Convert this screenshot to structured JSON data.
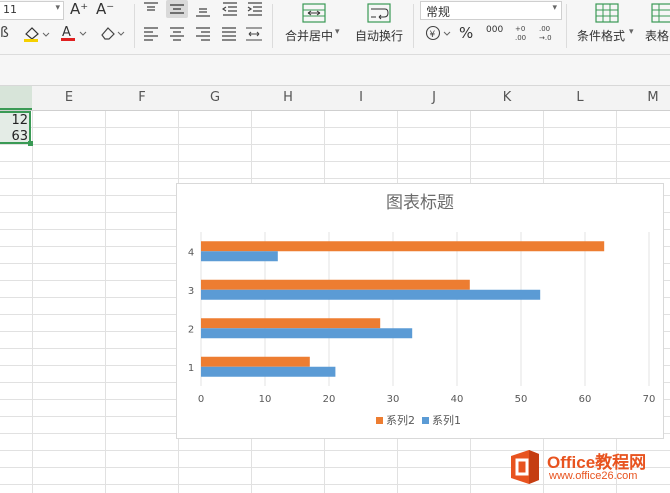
{
  "ribbon": {
    "font_size": "11",
    "font_increase": "A⁺",
    "font_decrease": "A⁻",
    "format_general": "常规",
    "merge_center": "合并居中",
    "wrap_text": "自动换行",
    "conditional_format": "条件格式",
    "table_style": "表格",
    "percent": "%",
    "thousands": "000",
    "dec_increase": "+0\n.00",
    "dec_decrease": ".00\n→.0"
  },
  "columns": [
    "E",
    "F",
    "G",
    "H",
    "I",
    "J",
    "K",
    "L",
    "M"
  ],
  "cells": {
    "d1": "12",
    "d2": "63"
  },
  "chart_data": {
    "type": "bar",
    "orientation": "horizontal",
    "title": "图表标题",
    "categories": [
      "1",
      "2",
      "3",
      "4"
    ],
    "series": [
      {
        "name": "系列2",
        "color": "#ed7d31",
        "values": [
          17,
          28,
          42,
          63
        ]
      },
      {
        "name": "系列1",
        "color": "#5b9bd5",
        "values": [
          21,
          33,
          53,
          12
        ]
      }
    ],
    "xlim": [
      0,
      70
    ],
    "xticks": [
      "0",
      "10",
      "20",
      "30",
      "40",
      "50",
      "60",
      "70"
    ],
    "grid": true,
    "legend_position": "bottom"
  },
  "watermark": {
    "brand": "Office教程网",
    "url": "www.office26.com"
  }
}
